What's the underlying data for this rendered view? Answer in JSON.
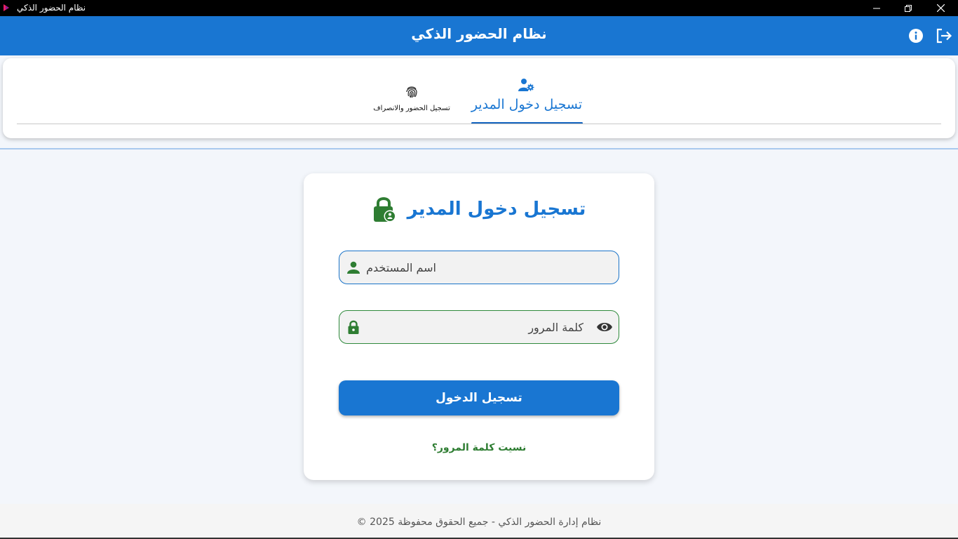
{
  "window": {
    "title": "نظام الحضور الذكي",
    "icon": "app-logo-icon",
    "controls": [
      "minimize-icon",
      "restore-icon",
      "close-icon"
    ]
  },
  "appbar": {
    "title": "نظام الحضور الذكي",
    "actions": [
      "info-icon",
      "logout-icon"
    ]
  },
  "tabs": [
    {
      "label": "تسجيل دخول المدير",
      "icon": "admin-settings-icon",
      "active": true
    },
    {
      "label": "تسجيل الحضور والانصراف",
      "icon": "fingerprint-icon",
      "active": false
    }
  ],
  "login": {
    "title": "تسجيل دخول المدير",
    "title_icon": "lock-person-icon",
    "username_placeholder": "اسم المستخدم",
    "username_value": "",
    "password_placeholder": "كلمة المرور",
    "password_value": "",
    "submit_label": "تسجيل الدخول",
    "forgot_label": "نسيت كلمة المرور؟"
  },
  "footer": {
    "text": "نظام إدارة الحضور الذكي - جميع الحقوق محفوظة 2025 ©"
  },
  "colors": {
    "primary": "#1976d2",
    "accent_green": "#2e7d32",
    "background": "#f3f6fb"
  }
}
